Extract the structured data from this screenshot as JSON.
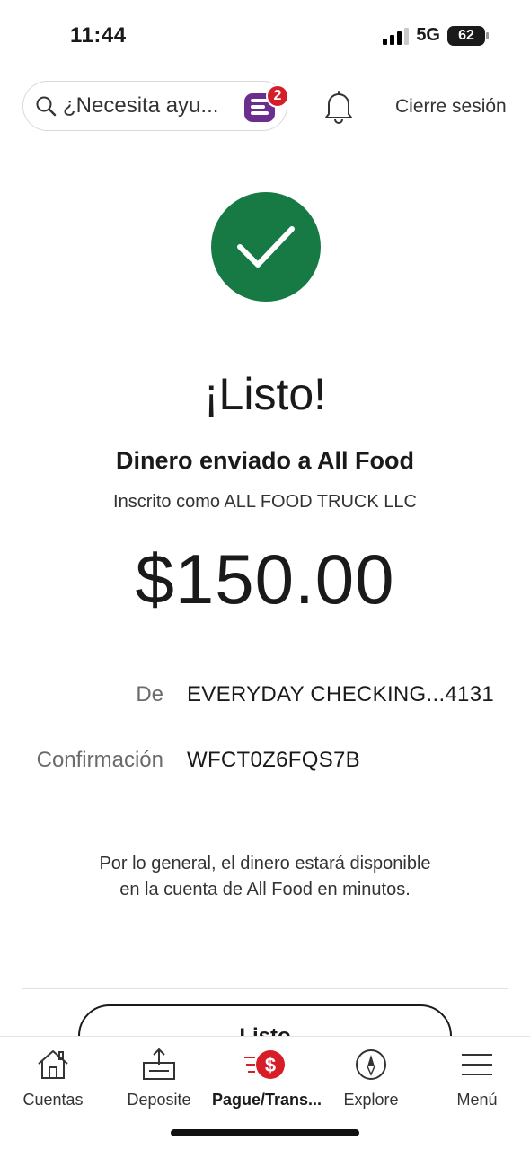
{
  "status_bar": {
    "time": "11:44",
    "network": "5G",
    "battery": "62"
  },
  "header": {
    "search_placeholder": "¿Necesita ayu...",
    "assistant_badge_count": "2",
    "logout_label": "Cierre sesión"
  },
  "confirmation": {
    "title": "¡Listo!",
    "subtitle": "Dinero enviado a All Food",
    "enrolled_as": "Inscrito como ALL FOOD TRUCK LLC",
    "amount": "$150.00",
    "details": [
      {
        "label": "De",
        "value": "EVERYDAY CHECKING...4131"
      },
      {
        "label": "Confirmación",
        "value": "WFCT0Z6FQS7B"
      }
    ],
    "note": "Por lo general, el dinero estará disponible en la cuenta de All Food en minutos.",
    "done_button": "Listo"
  },
  "bottom_nav": {
    "items": [
      {
        "label": "Cuentas",
        "icon": "home-icon"
      },
      {
        "label": "Deposite",
        "icon": "deposit-icon"
      },
      {
        "label": "Pague/Trans...",
        "icon": "pay-transfer-icon",
        "active": true
      },
      {
        "label": "Explore",
        "icon": "compass-icon"
      },
      {
        "label": "Menú",
        "icon": "hamburger-menu-icon"
      }
    ]
  },
  "colors": {
    "success_green": "#177a45",
    "brand_red": "#d71e28",
    "assistant_purple": "#6b2e8f"
  }
}
